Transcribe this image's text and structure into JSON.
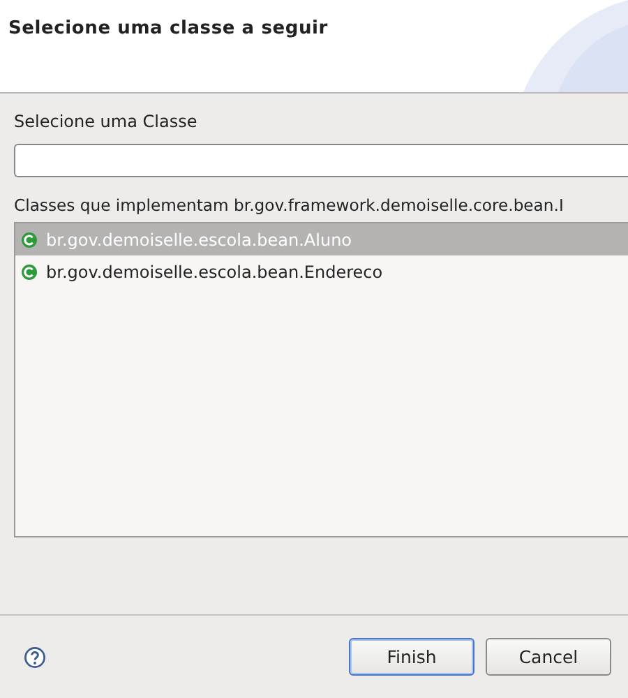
{
  "header": {
    "title": "Selecione uma classe a seguir"
  },
  "filter": {
    "label": "Selecione uma Classe"
  },
  "list": {
    "label": "Classes que implementam br.gov.framework.demoiselle.core.bean.I",
    "items": [
      {
        "text": "br.gov.demoiselle.escola.bean.Aluno",
        "selected": true
      },
      {
        "text": "br.gov.demoiselle.escola.bean.Endereco",
        "selected": false
      }
    ]
  },
  "buttons": [
    {
      "label": "Finish",
      "kind": "default"
    },
    {
      "label": "Cancel",
      "kind": "normal"
    }
  ]
}
